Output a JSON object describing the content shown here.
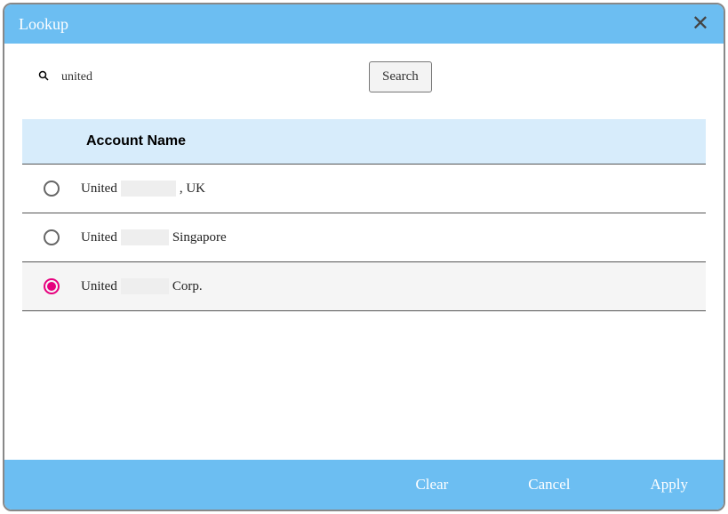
{
  "header": {
    "title": "Lookup"
  },
  "search": {
    "value": "united",
    "button_label": "Search"
  },
  "table": {
    "column_header": "Account Name",
    "rows": [
      {
        "prefix": "United",
        "redacted_width": 62,
        "suffix": ", UK",
        "selected": false
      },
      {
        "prefix": "United",
        "redacted_width": 54,
        "suffix": "Singapore",
        "selected": false
      },
      {
        "prefix": "United",
        "redacted_width": 54,
        "suffix": "Corp.",
        "selected": true
      }
    ]
  },
  "footer": {
    "clear_label": "Clear",
    "cancel_label": "Cancel",
    "apply_label": "Apply"
  }
}
